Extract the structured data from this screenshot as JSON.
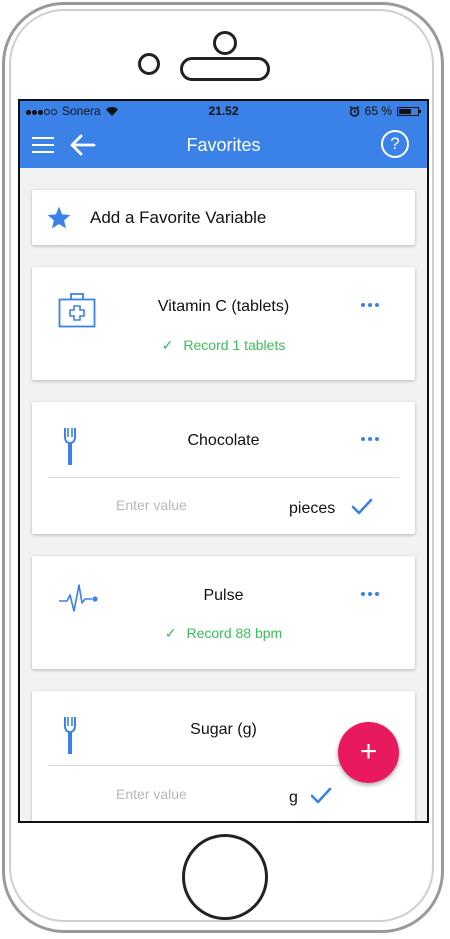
{
  "status_bar": {
    "carrier": "Sonera",
    "time": "21.52",
    "battery": "65 %",
    "battery_level": 0.65
  },
  "app_bar": {
    "title": "Favorites",
    "help_symbol": "?"
  },
  "add_favorite": {
    "label": "Add a Favorite Variable",
    "icon": "star-icon"
  },
  "favorites": [
    {
      "name": "Vitamin C (tablets)",
      "icon": "first-aid-kit-icon",
      "record_text": "Record 1 tablets"
    },
    {
      "name": "Chocolate",
      "icon": "fork-icon",
      "placeholder": "Enter value",
      "unit": "pieces"
    },
    {
      "name": "Pulse",
      "icon": "heartbeat-icon",
      "record_text": "Record 88 bpm"
    },
    {
      "name": "Sugar (g)",
      "icon": "fork-icon",
      "placeholder": "Enter value",
      "unit": "g"
    }
  ],
  "fab": {
    "symbol": "+"
  },
  "colors": {
    "primary": "#3a82e8",
    "accent": "#e8195d",
    "success": "#3cbf5a"
  }
}
